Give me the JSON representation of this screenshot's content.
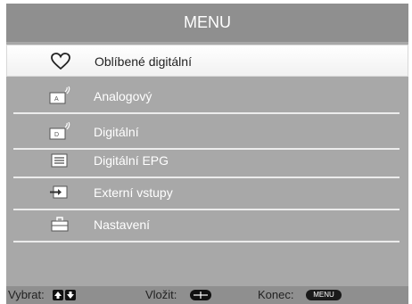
{
  "header": {
    "title": "MENU"
  },
  "menu": {
    "items": [
      {
        "label": "Oblíbené digitální",
        "icon": "heart-icon",
        "selected": true
      },
      {
        "label": "Analogový",
        "icon": "analog-tv-icon",
        "selected": false
      },
      {
        "label": "Digitální",
        "icon": "digital-tv-icon",
        "selected": false
      },
      {
        "label": "Digitální EPG",
        "icon": "epg-list-icon",
        "selected": false
      },
      {
        "label": "Externí vstupy",
        "icon": "external-input-icon",
        "selected": false
      },
      {
        "label": "Nastavení",
        "icon": "toolbox-icon",
        "selected": false
      }
    ]
  },
  "footer": {
    "select_label": "Vybrat:",
    "confirm_label": "Vložit:",
    "exit_label": "Konec:",
    "exit_key_label": "MENU"
  },
  "colors": {
    "panel": "#a8a8a8",
    "title_bar": "#8f8f8f",
    "selected_bg": "#ffffff",
    "text": "#ffffff"
  }
}
